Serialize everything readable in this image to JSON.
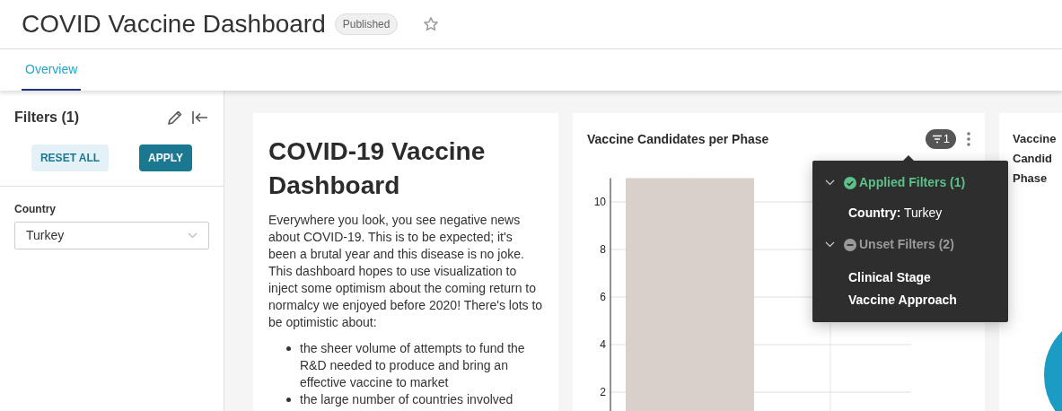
{
  "header": {
    "title": "COVID Vaccine Dashboard",
    "status_badge": "Published",
    "favorite": false
  },
  "tabs": [
    {
      "label": "Overview",
      "selected": true
    }
  ],
  "filters_panel": {
    "title": "Filters (1)",
    "buttons": [
      {
        "label": "RESET ALL",
        "kind": "secondary"
      },
      {
        "label": "APPLY",
        "kind": "primary"
      }
    ],
    "fields": [
      {
        "label": "Country",
        "value": "Turkey"
      }
    ]
  },
  "cards": [
    {
      "kind": "markdown",
      "heading": "COVID-19 Vaccine Dashboard",
      "paragraph": "Everywhere you look, you see negative news about COVID-19. This is to be expected; it's been a brutal year and this disease is no joke. This dashboard hopes to use visualization to inject some optimism about the coming return to normalcy we enjoyed before 2020! There's lots to be optimistic about:",
      "bullets": [
        "the sheer volume of attempts to fund the R&D needed to produce and bring an effective vaccine to market",
        "the large number of countries involved"
      ]
    },
    {
      "kind": "chart",
      "title": "Vaccine Candidates per Phase",
      "filter_count": "1",
      "chart_data": {
        "type": "bar",
        "values": [
          11
        ],
        "ylim": [
          0,
          11
        ],
        "grid": true,
        "yticks": [
          2,
          4,
          6,
          8,
          10
        ]
      },
      "filter_popover": {
        "sections": [
          {
            "kind": "applied",
            "title": "Applied Filters (1)",
            "expanded": true,
            "items": [
              "**Country:** Turkey"
            ]
          },
          {
            "kind": "unset",
            "title": "Unset Filters (2)",
            "expanded": true,
            "items": [
              "Clinical Stage",
              "Vaccine Approach"
            ]
          }
        ]
      }
    },
    {
      "kind": "donut_chart",
      "title": "Vaccine Candid Phase"
    }
  ]
}
